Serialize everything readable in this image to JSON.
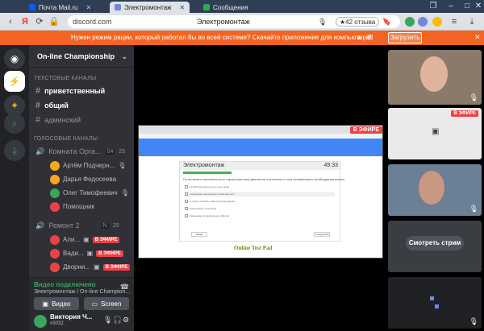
{
  "browser": {
    "tabs": [
      {
        "label": "Почта Mail.ru",
        "icon": "mail-icon",
        "color": "#005ff9"
      },
      {
        "label": "Электромонтаж",
        "icon": "discord-tab-icon",
        "color": "#7289da"
      },
      {
        "label": "Сообщения",
        "icon": "messages-icon",
        "color": "#34a853"
      }
    ],
    "url": "discord.com",
    "page_title": "Электромонтаж",
    "reviews": "★42 отзыва"
  },
  "banner": {
    "text": "Нужен режим рации, который работал бы во всей системе? Скачайте приложение для компьютера!",
    "download_label": "Загрузить",
    "close_glyph": "✕"
  },
  "server": {
    "name": "On-line Championship",
    "text_category": "ТЕКСТОВЫЕ КАНАЛЫ",
    "text_channels": [
      "приветственный",
      "общий",
      "админский"
    ],
    "voice_category": "ГОЛОСОВЫЕ КАНАЛЫ",
    "voice_channel_1": "Комната Орга...",
    "voice_channel_1_counts": [
      "04",
      "25"
    ],
    "voice_users_1": [
      "Артём Подчерн...",
      "Дарья Федосеева",
      "Олег Тимофеевич",
      "Помощник"
    ],
    "voice_channel_2": "Ремонт 2",
    "voice_channel_2_counts": [
      "N",
      "25"
    ],
    "voice_users_2": [
      "Али...",
      "Вади...",
      "Дворни..."
    ],
    "live_label": "В ЭФИРЕ"
  },
  "voice_panel": {
    "status": "Видео подключено",
    "channel": "Электромонтаж / On-line Champion...",
    "video_label": "Видео",
    "screen_label": "Screen"
  },
  "user_panel": {
    "name": "Виктория Ч...",
    "tag": "#3032"
  },
  "stream": {
    "live_label": "В ЭФИРЕ",
    "card_title": "Электромонтаж",
    "card_timer": "49:33",
    "question": "По величине механического характеристики двигателя постоянного тока независимого возбуждения можно",
    "options": [
      "ослабление магнитного поля якоря",
      "повышение напряжения питающей сети",
      "в 2 раза ослабить обмотку возбуждения",
      "уменьшение тока якоря",
      "изменение сопротивления обмоток"
    ],
    "prev_label": "Назад",
    "next_label": "Следующий",
    "logo": "Online Test Pad"
  },
  "right": {
    "tile2_live": "В ЭФИРЕ",
    "watch_label": "Смотреть стрим"
  }
}
